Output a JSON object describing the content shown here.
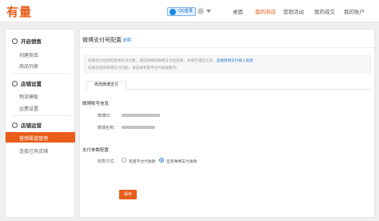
{
  "header": {
    "logo": "有量",
    "qq_badge": "QQ登录",
    "nav": [
      "桌面",
      "我的商店",
      "营销活动",
      "我的成交",
      "我的账户"
    ],
    "active_nav": "我的商店",
    "accent_color": "#e85d1a"
  },
  "sidebar": {
    "groups": [
      {
        "title": "开启销售",
        "items": [
          "创建商品",
          "商品列表"
        ]
      },
      {
        "title": "店铺设置",
        "items": [
          "物流模板",
          "运费设置"
        ]
      },
      {
        "title": "店铺运营",
        "items": [
          "营销渠道管理",
          "连接已有店铺"
        ]
      }
    ],
    "active_item": "营销渠道管理"
  },
  "main": {
    "title": "微博支付号配置",
    "help_link": "说明",
    "notice": {
      "line1_text": "如果您已经拥有微博支付功能，请选择拥有微博支付后收款，并填写相应信息。",
      "line1_link": "查看微博支付接入指南",
      "line2_text": "如果您没有微博支付功能，请选择有量平台代收款服务。"
    },
    "tab": "修改微博支付",
    "account_section": {
      "title": "微博账号信息",
      "fields": [
        {
          "label": "微博ID："
        },
        {
          "label": "微博名称："
        }
      ]
    },
    "payment_section": {
      "title": "支付参数配置",
      "label": "收款方式：",
      "options": [
        "有量平台代收款",
        "自有微博支付收款"
      ],
      "selected": "自有微博支付收款"
    },
    "save_button": "保存"
  }
}
